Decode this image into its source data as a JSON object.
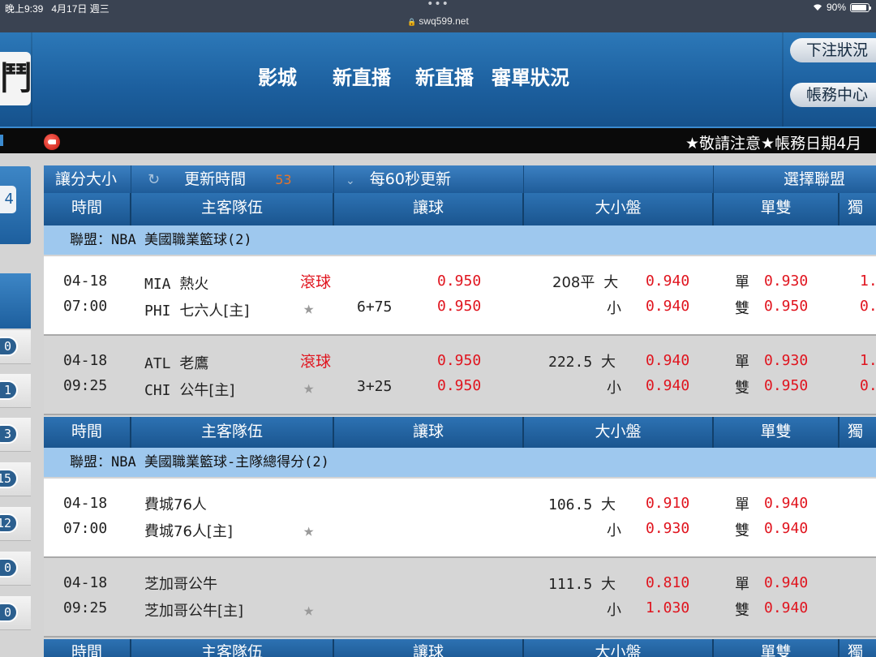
{
  "status_bar": {
    "time": "晚上9:39",
    "date": "4月17日 週三",
    "url": "swq599.net",
    "battery": "90%"
  },
  "header": {
    "logo_glyph": "鬥",
    "nav": [
      "影城",
      "新直播",
      "新直播",
      "審單狀況"
    ],
    "bet_status_button": "下注狀況",
    "account_center_button": "帳務中心"
  },
  "marquee": {
    "text": "★敬請注意★帳務日期4月"
  },
  "sidebar": {
    "top_button_glyph": "4",
    "counts": [
      "0",
      "1",
      "3",
      "15",
      "12",
      "0",
      "0"
    ]
  },
  "toolbar": {
    "handicap_label": "讓分大小",
    "refresh_icon": "↻",
    "refresh_label": "更新時間",
    "countdown": "53",
    "chevron": "⌄",
    "interval_label": "每60秒更新",
    "select_league": "選擇聯盟"
  },
  "columns": [
    "時間",
    "主客隊伍",
    "讓球",
    "大小盤",
    "單雙",
    "獨"
  ],
  "leagues": [
    {
      "name": "聯盟：NBA 美國職業籃球(2)",
      "matches": [
        {
          "date": "04-18",
          "time": "07:00",
          "home_code": "MIA",
          "home": "熱火",
          "away_code": "PHI",
          "away": "七六人[主]",
          "live": "滾球",
          "handicap": "6+75",
          "hdp_odds_1": "0.950",
          "hdp_odds_2": "0.950",
          "ou_line": "208平",
          "over": "大",
          "under": "小",
          "over_odds": "0.940",
          "under_odds": "0.940",
          "odd_label": "單",
          "even_label": "雙",
          "odd_odds": "0.930",
          "even_odds": "0.950",
          "extra_1": "1.",
          "extra_2": "0."
        },
        {
          "date": "04-18",
          "time": "09:25",
          "home_code": "ATL",
          "home": "老鷹",
          "away_code": "CHI",
          "away": "公牛[主]",
          "live": "滾球",
          "handicap": "3+25",
          "hdp_odds_1": "0.950",
          "hdp_odds_2": "0.950",
          "ou_line": "222.5",
          "over": "大",
          "under": "小",
          "over_odds": "0.940",
          "under_odds": "0.940",
          "odd_label": "單",
          "even_label": "雙",
          "odd_odds": "0.930",
          "even_odds": "0.950",
          "extra_1": "1.",
          "extra_2": "0."
        }
      ]
    },
    {
      "name": "聯盟：NBA 美國職業籃球-主隊總得分(2)",
      "matches": [
        {
          "date": "04-18",
          "time": "07:00",
          "home": "費城76人",
          "away": "費城76人[主]",
          "ou_line": "106.5",
          "over": "大",
          "under": "小",
          "over_odds": "0.910",
          "under_odds": "0.930",
          "odd_label": "單",
          "even_label": "雙",
          "odd_odds": "0.940",
          "even_odds": "0.940"
        },
        {
          "date": "04-18",
          "time": "09:25",
          "home": "芝加哥公牛",
          "away": "芝加哥公牛[主]",
          "ou_line": "111.5",
          "over": "大",
          "under": "小",
          "over_odds": "0.810",
          "under_odds": "1.030",
          "odd_label": "單",
          "even_label": "雙",
          "odd_odds": "0.940",
          "even_odds": "0.940"
        }
      ]
    }
  ],
  "colors": {
    "header_blue": "#1c5f9e",
    "league_band": "#9ec8ee",
    "odds_red": "#e0141e",
    "countdown_orange": "#e5752a"
  }
}
